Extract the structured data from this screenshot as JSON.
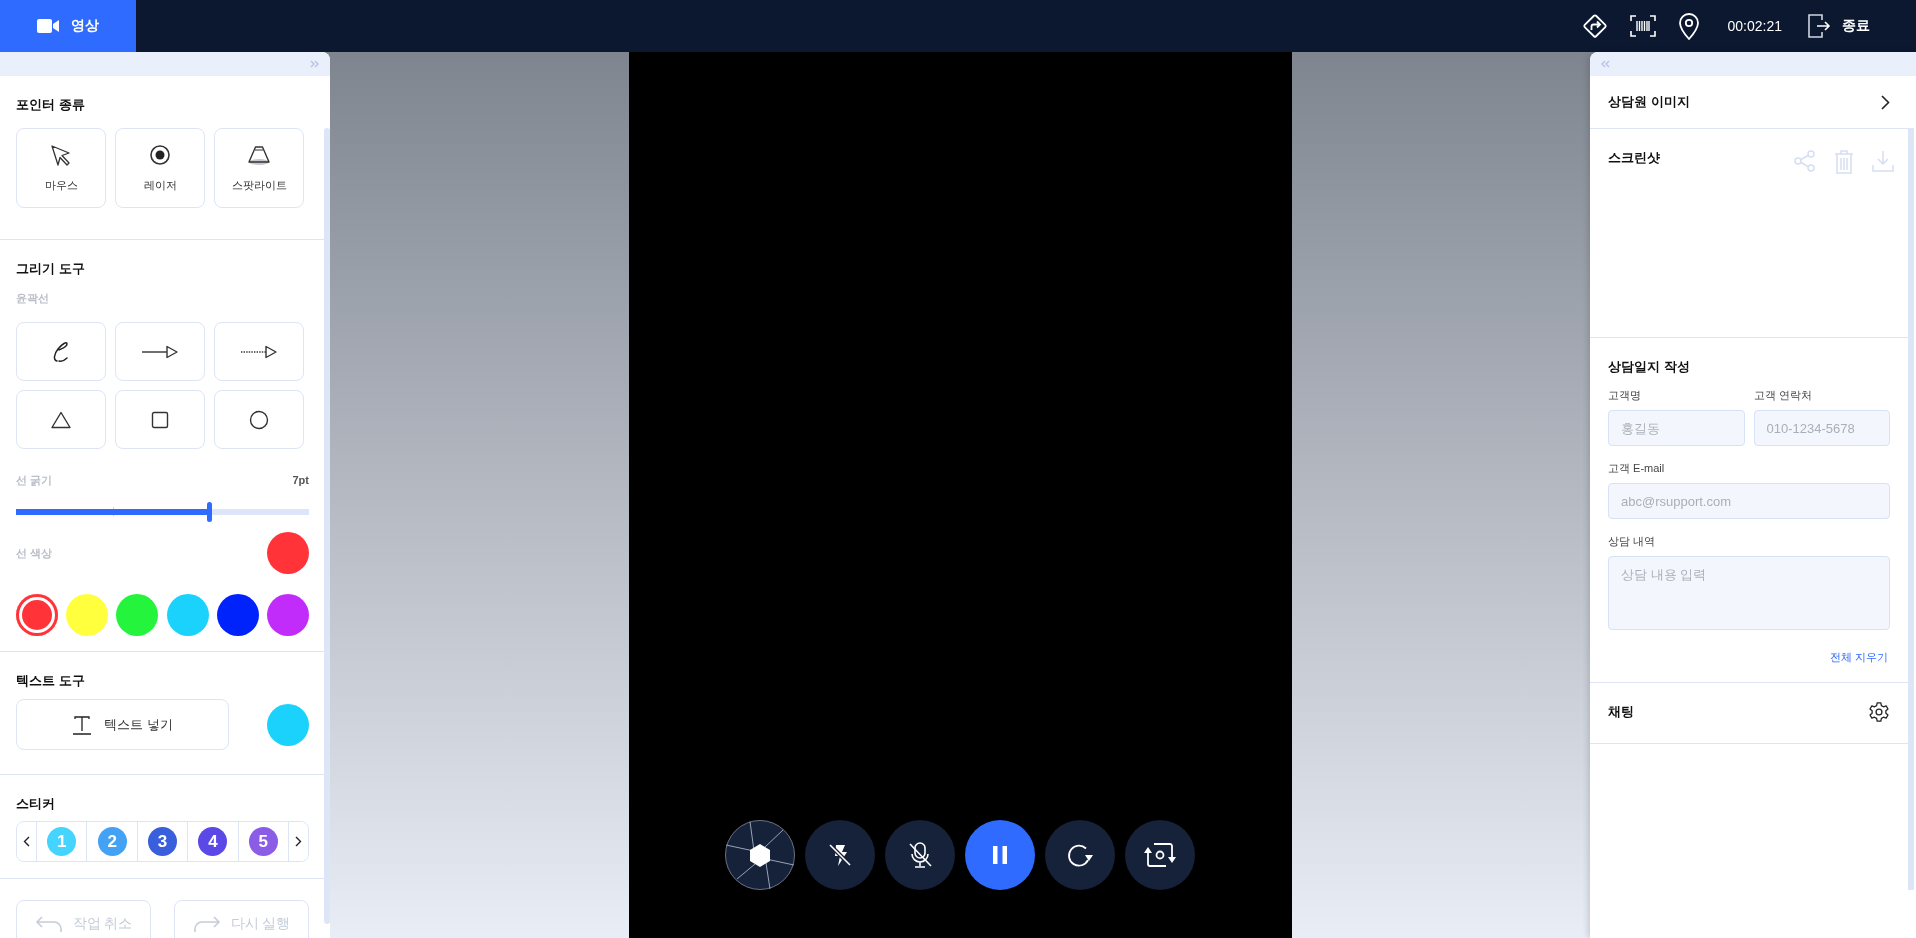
{
  "header": {
    "tabs": [
      {
        "label": "영상",
        "kind": "video",
        "selected": true
      }
    ],
    "tools": [
      {
        "kind": "direction"
      },
      {
        "kind": "barcode"
      },
      {
        "kind": "location"
      }
    ],
    "timer": "00:02:21",
    "exit": {
      "label": "종료"
    }
  },
  "left_panel": {
    "pointer": {
      "title": "포인터 종류",
      "options": [
        {
          "label": "마우스",
          "kind": "cursor",
          "selected": false
        },
        {
          "label": "레이저",
          "kind": "laser",
          "selected": false
        },
        {
          "label": "스팟라이트",
          "kind": "spotlight",
          "selected": false
        }
      ]
    },
    "drawing": {
      "title": "그리기 도구",
      "subtitle": "윤곽선",
      "tools": [
        {
          "kind": "pen",
          "selected": false
        },
        {
          "kind": "arrow",
          "selected": false
        },
        {
          "kind": "dotted-arrow",
          "selected": false
        },
        {
          "kind": "triangle",
          "selected": false
        },
        {
          "kind": "square",
          "selected": false
        },
        {
          "kind": "circle",
          "selected": false
        }
      ],
      "thickness": {
        "label": "선 굵기",
        "value": "7pt",
        "level": 0.66
      },
      "line_color": {
        "label": "선 색상",
        "color": "#ff3338"
      },
      "palette": [
        {
          "color": "#ff3338",
          "selected": true
        },
        {
          "color": "#ffff3d",
          "selected": false
        },
        {
          "color": "#25f43d",
          "selected": false
        },
        {
          "color": "#1ad2fb",
          "selected": false
        },
        {
          "color": "#0022fb",
          "selected": false
        },
        {
          "color": "#c22cfb",
          "selected": false
        }
      ]
    },
    "text_tool": {
      "title": "텍스트 도구",
      "button": "텍스트 넣기",
      "color": "#1ad2fb"
    },
    "stickers": {
      "title": "스티커",
      "items": [
        {
          "label": "1",
          "color": "#45d4fe"
        },
        {
          "label": "2",
          "color": "#44a2f4"
        },
        {
          "label": "3",
          "color": "#3a5fdc"
        },
        {
          "label": "4",
          "color": "#5c48e6"
        },
        {
          "label": "5",
          "color": "#8b5ce6"
        }
      ]
    },
    "actions": [
      {
        "label": "작업 취소",
        "kind": "undo",
        "disabled": true
      },
      {
        "label": "다시 실행",
        "kind": "redo",
        "disabled": true
      }
    ]
  },
  "video": {
    "controls": [
      {
        "kind": "capture",
        "active": false
      },
      {
        "kind": "flash-off",
        "active": false
      },
      {
        "kind": "mic-off",
        "active": false
      },
      {
        "kind": "pause",
        "active": true
      },
      {
        "kind": "rotate",
        "active": false
      },
      {
        "kind": "switch-camera",
        "active": false
      }
    ]
  },
  "right_panel": {
    "agent_image": {
      "title": "상담원 이미지"
    },
    "screenshot": {
      "title": "스크린샷",
      "actions": [
        {
          "kind": "share",
          "disabled": true
        },
        {
          "kind": "delete",
          "disabled": true
        },
        {
          "kind": "download",
          "disabled": true
        }
      ]
    },
    "log": {
      "title": "상담일지 작성",
      "rows": [
        {
          "fields": [
            {
              "label": "고객명",
              "placeholder": "홍길동",
              "kind": "input"
            },
            {
              "label": "고객 연락처",
              "placeholder": "010-1234-5678",
              "kind": "input"
            }
          ]
        },
        {
          "fields": [
            {
              "label": "고객 E-mail",
              "placeholder": "abc@rsupport.com",
              "kind": "input"
            }
          ]
        },
        {
          "fields": [
            {
              "label": "상담 내역",
              "placeholder": "상담 내용 입력",
              "kind": "textarea"
            }
          ]
        }
      ],
      "clear_label": "전체 지우기"
    },
    "chat": {
      "title": "채팅"
    }
  }
}
